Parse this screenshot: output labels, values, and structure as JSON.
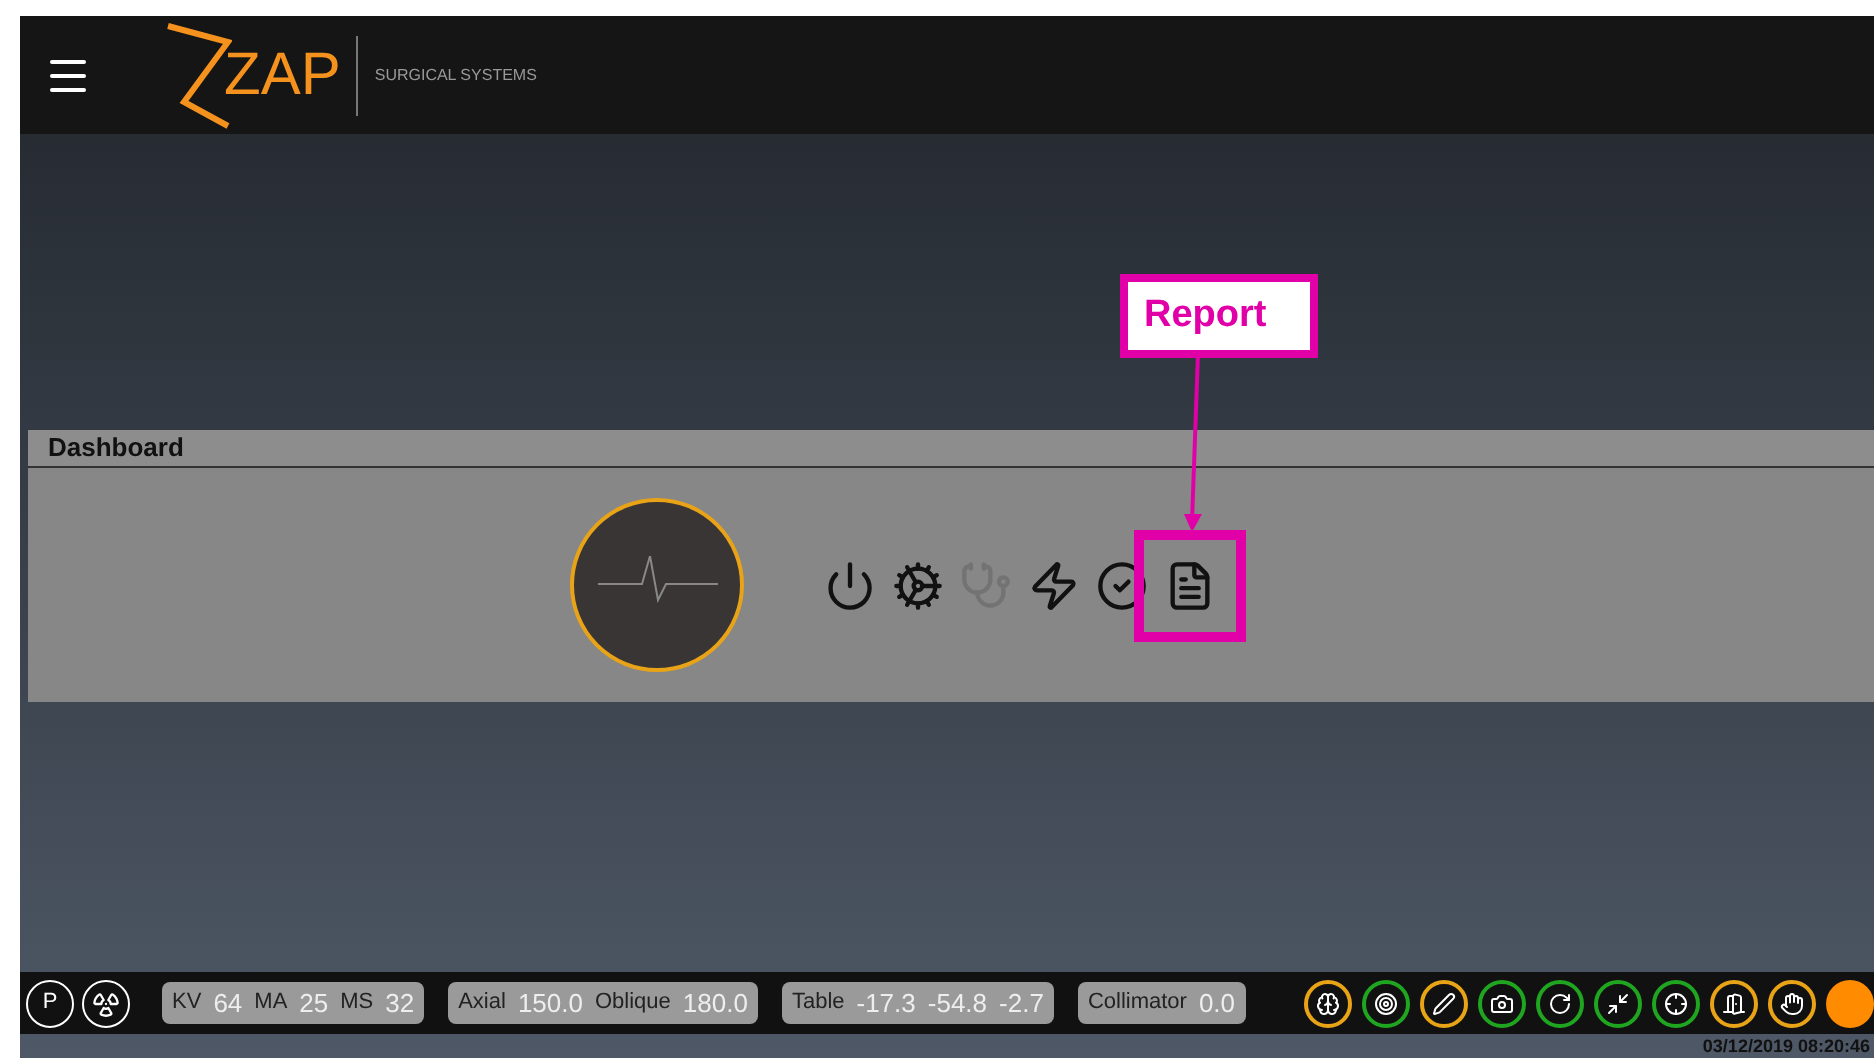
{
  "header": {
    "logo_text": "ZAP",
    "tagline": "SURGICAL SYSTEMS"
  },
  "annotation": {
    "label": "Report"
  },
  "dashboard": {
    "title": "Dashboard",
    "tools": [
      {
        "kind": "power",
        "disabled": false,
        "highlighted": false
      },
      {
        "kind": "settings",
        "disabled": false,
        "highlighted": false
      },
      {
        "kind": "stethoscope",
        "disabled": true,
        "highlighted": false
      },
      {
        "kind": "bolt",
        "disabled": false,
        "highlighted": false
      },
      {
        "kind": "check",
        "disabled": false,
        "highlighted": false
      },
      {
        "kind": "report",
        "disabled": false,
        "highlighted": true
      }
    ]
  },
  "status_bar": {
    "mode_buttons": [
      {
        "kind": "text",
        "label": "P"
      },
      {
        "kind": "radiation"
      }
    ],
    "groups": [
      {
        "items": [
          {
            "label": "KV",
            "value": "64"
          },
          {
            "label": "MA",
            "value": "25"
          },
          {
            "label": "MS",
            "value": "32"
          }
        ]
      },
      {
        "items": [
          {
            "label": "Axial",
            "value": "150.0"
          },
          {
            "label": "Oblique",
            "value": "180.0"
          }
        ]
      },
      {
        "items": [
          {
            "label": "Table",
            "value": "-17.3"
          },
          {
            "value": "-54.8"
          },
          {
            "value": "-2.7"
          }
        ]
      },
      {
        "items": [
          {
            "label": "Collimator",
            "value": "0.0"
          }
        ]
      }
    ],
    "indicators": [
      {
        "kind": "head",
        "color": "#e8a317"
      },
      {
        "kind": "target",
        "color": "#1fa51f"
      },
      {
        "kind": "probe",
        "color": "#e8a317"
      },
      {
        "kind": "camera",
        "color": "#1fa51f"
      },
      {
        "kind": "rotate",
        "color": "#1fa51f"
      },
      {
        "kind": "couch",
        "color": "#1fa51f"
      },
      {
        "kind": "align",
        "color": "#1fa51f"
      },
      {
        "kind": "door",
        "color": "#e8a317"
      },
      {
        "kind": "hand",
        "color": "#e8a317"
      }
    ],
    "status_dot": {
      "color": "#ff8c00"
    },
    "timestamp": "03/12/2019 08:20:46"
  }
}
